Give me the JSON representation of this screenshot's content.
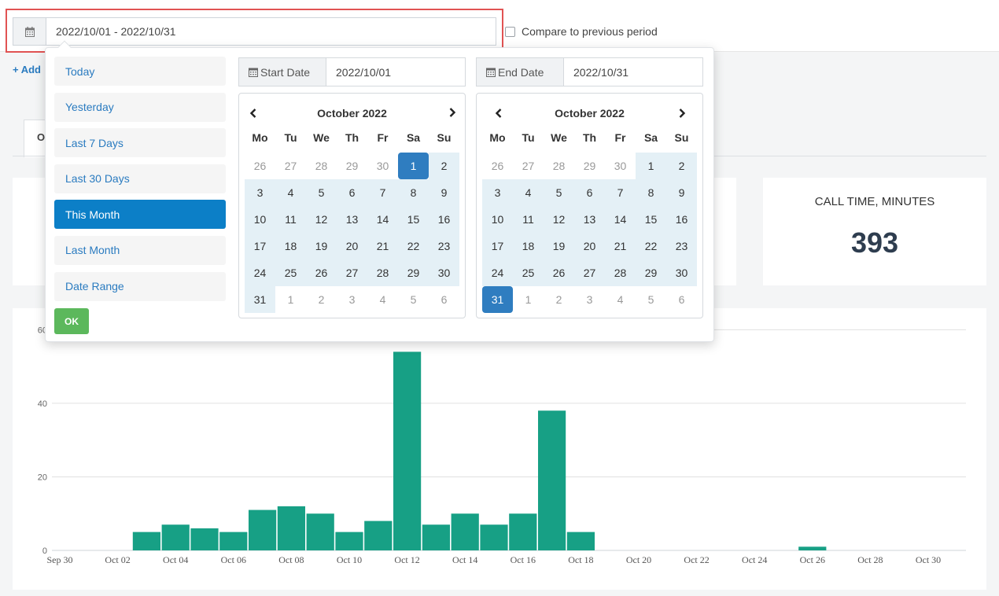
{
  "filter": {
    "date_range_value": "2022/10/01 - 2022/10/31",
    "compare_label": "Compare to previous period",
    "calendar_icon": "calendar-icon"
  },
  "add_link": "+ Add",
  "tab_first_letter": "O",
  "stats": {
    "call_time_title": "CALL TIME, MINUTES",
    "call_time_value": "393"
  },
  "picker": {
    "ranges": [
      "Today",
      "Yesterday",
      "Last 7 Days",
      "Last 30 Days",
      "This Month",
      "Last Month",
      "Date Range"
    ],
    "active_range": "This Month",
    "ok_label": "OK",
    "start_label": "Start Date",
    "start_value": "2022/10/01",
    "end_label": "End Date",
    "end_value": "2022/10/31",
    "left_month": "October 2022",
    "right_month": "October 2022",
    "weekdays": [
      "Mo",
      "Tu",
      "We",
      "Th",
      "Fr",
      "Sa",
      "Su"
    ],
    "days": [
      "26",
      "27",
      "28",
      "29",
      "30",
      "1",
      "2",
      "3",
      "4",
      "5",
      "6",
      "7",
      "8",
      "9",
      "10",
      "11",
      "12",
      "13",
      "14",
      "15",
      "16",
      "17",
      "18",
      "19",
      "20",
      "21",
      "22",
      "23",
      "24",
      "25",
      "26",
      "27",
      "28",
      "29",
      "30",
      "31",
      "1",
      "2",
      "3",
      "4",
      "5",
      "6"
    ],
    "accent": "#2f7dc0",
    "range_bg": "#e4f0f6"
  },
  "chart_data": {
    "type": "bar",
    "x": [
      "Sep 30",
      "Oct 01",
      "Oct 02",
      "Oct 03",
      "Oct 04",
      "Oct 05",
      "Oct 06",
      "Oct 07",
      "Oct 08",
      "Oct 09",
      "Oct 10",
      "Oct 11",
      "Oct 12",
      "Oct 13",
      "Oct 14",
      "Oct 15",
      "Oct 16",
      "Oct 17",
      "Oct 18",
      "Oct 19",
      "Oct 20",
      "Oct 21",
      "Oct 22",
      "Oct 23",
      "Oct 24",
      "Oct 25",
      "Oct 26",
      "Oct 27",
      "Oct 28",
      "Oct 29",
      "Oct 30",
      "Oct 31"
    ],
    "values": [
      0,
      0,
      0,
      5,
      7,
      6,
      5,
      11,
      12,
      10,
      5,
      8,
      54,
      7,
      10,
      7,
      10,
      38,
      5,
      0,
      0,
      0,
      0,
      0,
      0,
      0,
      1,
      0,
      0,
      0,
      0,
      0
    ],
    "xtick_labels": [
      "Sep 30",
      "Oct 02",
      "Oct 04",
      "Oct 06",
      "Oct 08",
      "Oct 10",
      "Oct 12",
      "Oct 14",
      "Oct 16",
      "Oct 18",
      "Oct 20",
      "Oct 22",
      "Oct 24",
      "Oct 26",
      "Oct 28",
      "Oct 30"
    ],
    "yticks": [
      0,
      20,
      40,
      60
    ],
    "ylim": [
      0,
      62
    ],
    "grid": true,
    "color": "#17a085"
  }
}
